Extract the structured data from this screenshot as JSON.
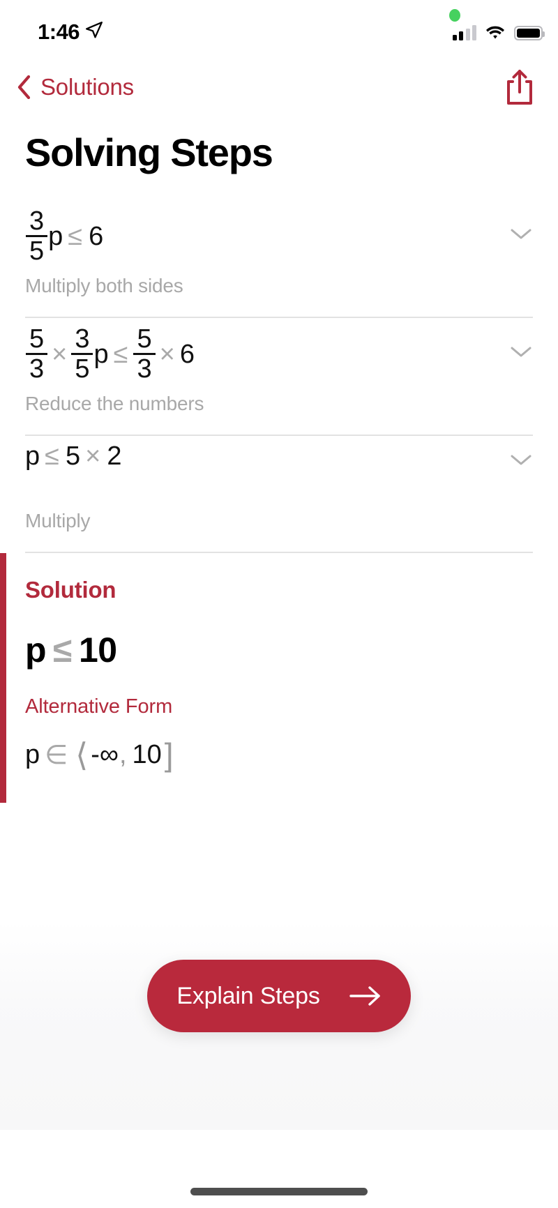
{
  "status_bar": {
    "time": "1:46",
    "location_icon": "location-arrow-icon",
    "recording_indicator": "green-dot-icon",
    "signal_icon": "cellular-signal-icon",
    "wifi_icon": "wifi-icon",
    "battery_icon": "battery-full-icon"
  },
  "nav": {
    "back_label": "Solutions",
    "back_icon": "chevron-left-icon",
    "share_icon": "share-icon"
  },
  "page": {
    "title": "Solving Steps"
  },
  "steps": [
    {
      "expression_text": "3/5 p ≤ 6",
      "numerator": "3",
      "denominator": "5",
      "variable": "p",
      "relation": "≤",
      "rhs": "6",
      "hint": "Multiply both sides",
      "chevron": "chevron-down-icon"
    },
    {
      "expression_text": "5/3 × 3/5 p ≤ 5/3 × 6",
      "left_frac_num": "5",
      "left_frac_den": "3",
      "times1": "×",
      "mid_frac_num": "3",
      "mid_frac_den": "5",
      "variable": "p",
      "relation": "≤",
      "right_frac_num": "5",
      "right_frac_den": "3",
      "times2": "×",
      "rhs": "6",
      "hint": "Reduce the numbers",
      "chevron": "chevron-down-icon"
    },
    {
      "expression_text": "p ≤ 5 × 2",
      "variable": "p",
      "relation": "≤",
      "lhs_num": "5",
      "times": "×",
      "rhs_num": "2",
      "hint": "Multiply",
      "chevron": "chevron-down-icon"
    }
  ],
  "solution": {
    "title": "Solution",
    "variable": "p",
    "relation": "≤",
    "value": "10",
    "expression_text": "p ≤ 10",
    "alternative_title": "Alternative Form",
    "alternative": {
      "variable": "p",
      "member_of": "∈",
      "open_bracket": "⟨",
      "lower": "-∞",
      "comma": ",",
      "upper": "10",
      "close_bracket": "]",
      "expression_text": "p ∈ ⟨-∞, 10]"
    }
  },
  "cta": {
    "label": "Explain Steps",
    "arrow_icon": "arrow-right-icon"
  },
  "home_indicator": "home-indicator",
  "colors": {
    "brand_red": "#b22a3c",
    "button_red": "#b9293c",
    "muted_gray": "#a8a8a8",
    "operator_gray": "#a9a9a9",
    "divider": "#e2e2e2",
    "text_black": "#111111",
    "recording_green": "#46d15f"
  }
}
